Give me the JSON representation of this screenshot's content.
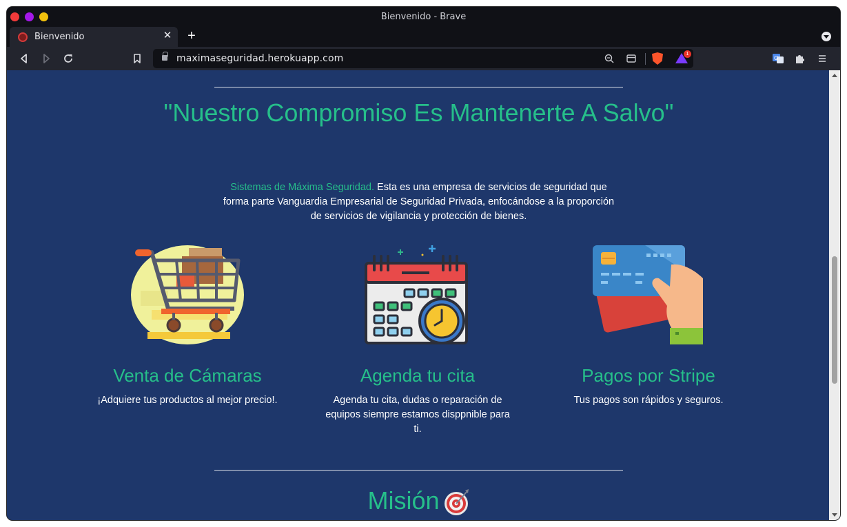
{
  "window": {
    "title": "Bienvenido - Brave"
  },
  "tab": {
    "title": "Bienvenido",
    "close": "✕",
    "new_tab": "+"
  },
  "toolbar": {
    "url": "maximaseguridad.herokuapp.com",
    "rewards_badge": "1"
  },
  "page": {
    "slogan": "\"Nuestro Compromiso Es Mantenerte A Salvo\"",
    "intro_highlight": "Sistemas de Máxima Seguridad.",
    "intro_text": " Esta es una empresa de servicios de seguridad que forma parte Vanguardia Empresarial de Seguridad Privada, enfocándose a la proporción de servicios de vigilancia y protección de bienes.",
    "features": [
      {
        "title": "Venta de Cámaras",
        "description": "¡Adquiere tus productos al mejor precio!.",
        "icon": "shopping-cart-icon"
      },
      {
        "title": "Agenda tu cita",
        "description": "Agenda tu cita, dudas o reparación de equipos siempre estamos disppnible para ti.",
        "icon": "calendar-clock-icon"
      },
      {
        "title": "Pagos por Stripe",
        "description": "Tus pagos son rápidos y seguros.",
        "icon": "credit-card-icon"
      }
    ],
    "mision_title": "Misión"
  },
  "colors": {
    "background": "#1e376b",
    "accent": "#26bf8a"
  }
}
